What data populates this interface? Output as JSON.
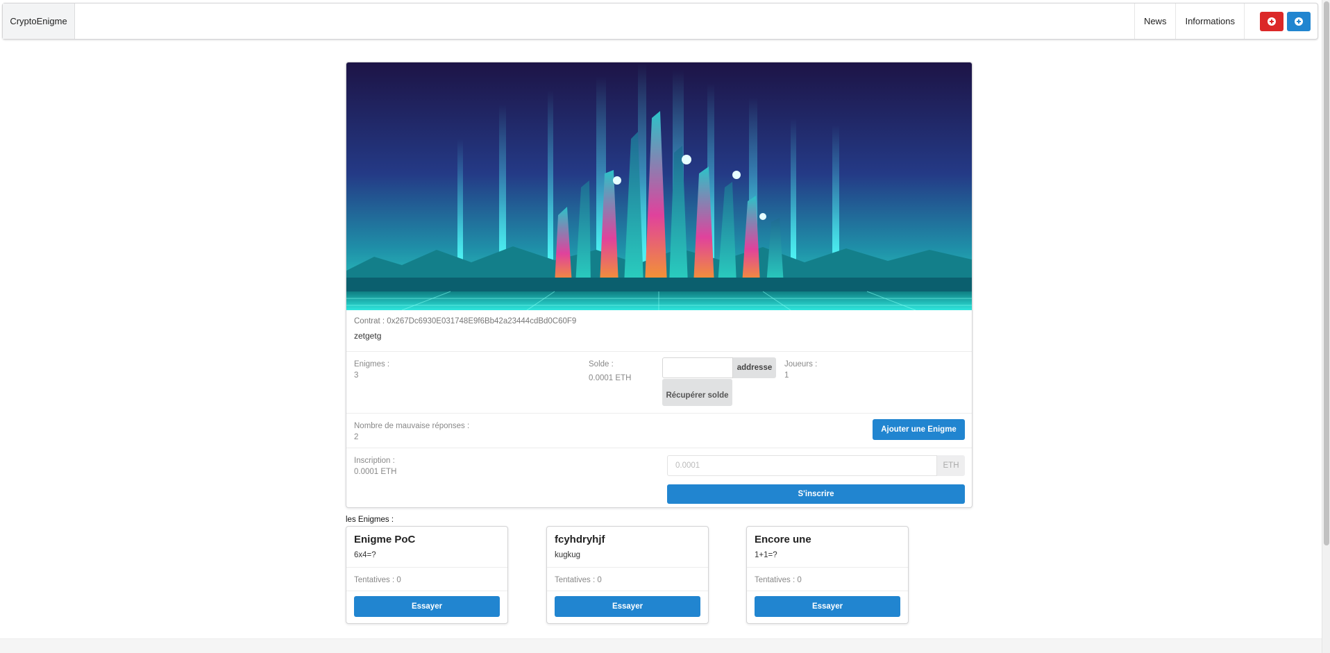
{
  "nav": {
    "brand": "CryptoEnigme",
    "items": [
      "News",
      "Informations"
    ],
    "buttons": [
      {
        "icon": "plus-circle-icon",
        "color": "#db2828"
      },
      {
        "icon": "plus-circle-icon",
        "color": "#2185d0"
      }
    ]
  },
  "contract": {
    "address": "Contrat : 0x267Dc6930E031748E9f6Bb42a23444cdBd0C60F9",
    "description": "zetgetg",
    "enigmes_label": "Enigmes :",
    "enigmes_value": "3",
    "solde_label": "Solde :",
    "solde_value": "0.0001 ETH",
    "address_input_value": "",
    "address_label": "addresse",
    "recuperer_button": "Récupérer solde",
    "joueurs_label": "Joueurs :",
    "joueurs_value": "1",
    "wrong_label": "Nombre de mauvaise réponses :",
    "wrong_value": "2",
    "add_enigme_button": "Ajouter une Enigme",
    "inscription_label": "Inscription :",
    "inscription_value": "0.0001 ETH",
    "eth_placeholder": "0.0001",
    "eth_unit": "ETH",
    "inscrire_button": "S'inscrire"
  },
  "enigmes_section": {
    "title": "les Enigmes :",
    "cards": [
      {
        "title": "Enigme PoC",
        "question": "6x4=?",
        "tentatives": "Tentatives : 0",
        "button": "Essayer"
      },
      {
        "title": "fcyhdryhjf",
        "question": "kugkug",
        "tentatives": "Tentatives : 0",
        "button": "Essayer"
      },
      {
        "title": "Encore une",
        "question": "1+1=?",
        "tentatives": "Tentatives : 0",
        "button": "Essayer"
      }
    ]
  },
  "colors": {
    "primary": "#2185d0",
    "danger": "#db2828"
  }
}
